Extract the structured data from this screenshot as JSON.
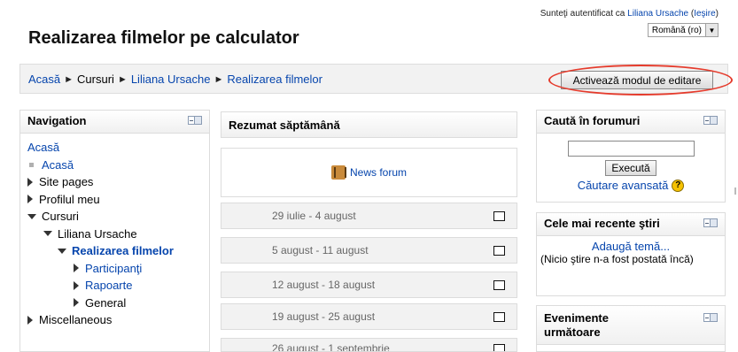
{
  "header": {
    "site_title": "Realizarea filmelor pe calculator",
    "login_prefix": "Sunteţi autentificat ca ",
    "user_name": "Liliana Ursache",
    "logout_open": " (",
    "logout_label": "Ieşire",
    "logout_close": ")",
    "language": "Română (ro)"
  },
  "breadcrumb": {
    "items": [
      "Acasă",
      "Cursuri",
      "Liliana Ursache",
      "Realizarea filmelor"
    ],
    "separator": "►"
  },
  "edit_button": {
    "label": "Activează modul de editare"
  },
  "navigation": {
    "title": "Navigation",
    "root": "Acasă",
    "items": {
      "home": "Acasă",
      "site_pages": "Site pages",
      "profile": "Profilul meu",
      "courses": "Cursuri",
      "teacher": "Liliana Ursache",
      "course": "Realizarea filmelor",
      "participants": "Participanţi",
      "reports": "Rapoarte",
      "general": "General",
      "misc": "Miscellaneous"
    }
  },
  "center": {
    "summary_title": "Rezumat săptămână",
    "news_forum": "News forum",
    "weeks": [
      "29 iulie - 4 august",
      "5 august - 11 august",
      "12 august - 18 august",
      "19 august - 25 august",
      "26 august - 1 septembrie"
    ]
  },
  "search_block": {
    "title": "Caută în forumuri",
    "input_value": "",
    "execute_label": "Execută",
    "advanced_label": "Căutare avansată",
    "help_glyph": "?"
  },
  "news_block": {
    "title": "Cele mai recente ştiri",
    "add_topic": "Adaugă temă...",
    "empty_text": "(Nicio ştire n-a fost postată încă)"
  },
  "events_block": {
    "title": "Evenimente următoare"
  },
  "colors": {
    "link": "#0645ad",
    "highlight_ellipse": "#e53b2c",
    "navbar_bg": "#f2f2f2"
  }
}
